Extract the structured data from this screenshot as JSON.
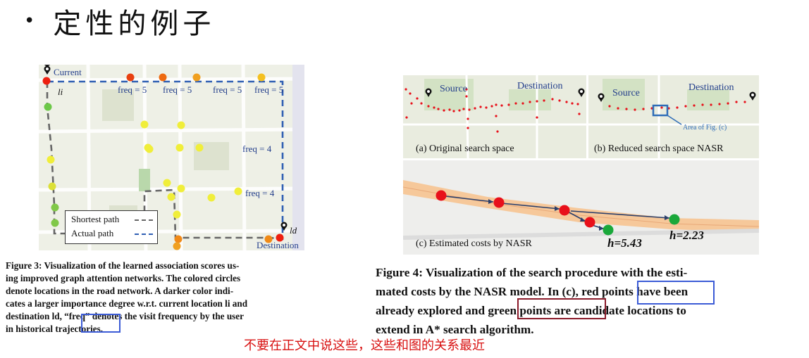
{
  "slide": {
    "title": "定性的例子",
    "bullet": "•"
  },
  "figure3": {
    "labels": {
      "current": "Current",
      "li": "li",
      "ld": "ld",
      "destination": "Destination",
      "freq_top": [
        "freq = 5",
        "freq = 5",
        "freq = 5",
        "freq = 5"
      ],
      "freq_right_1": "freq = 4",
      "freq_right_2": "freq = 4"
    },
    "legend": {
      "shortest": "Shortest path",
      "actual": "Actual path"
    },
    "caption_lines": [
      "Figure 3: Visualization of the learned association scores us-",
      "ing improved graph attention networks. The colored circles",
      "denote locations in the road network. A darker color indi-",
      "cates a larger importance degree w.r.t. current location li and",
      "destination ld, “freq” denotes the visit frequency by the user",
      "in historical trajectories."
    ],
    "colors": {
      "path_blue": "#2f5fb3",
      "path_gray": "#666666"
    }
  },
  "figure4": {
    "panel_a": {
      "source": "Source",
      "destination": "Destination",
      "caption": "(a) Original search space"
    },
    "panel_b": {
      "source": "Source",
      "destination": "Destination",
      "area": "Area of Fig. (c)",
      "caption": "(b) Reduced search space NASR"
    },
    "panel_c": {
      "caption": "(c) Estimated costs by NASR",
      "h1": "h=5.43",
      "h2": "h=2.23"
    },
    "caption_lines": [
      "Figure 4: Visualization of the search procedure with the esti-",
      "mated costs by the NASR model. In (c), red points have been",
      "already explored and green points are candidate locations to",
      "extend in A* search algorithm."
    ],
    "colors": {
      "red": "#e8101a",
      "green": "#1aa83a",
      "road": "#f6c89a"
    }
  },
  "annotation": {
    "note": "不要在正文中说这些，这些和图的关系最近",
    "colors": {
      "blue_box": "#3b5bd6",
      "maroon_box": "#8a1a2a",
      "note_red": "#d81010"
    }
  }
}
